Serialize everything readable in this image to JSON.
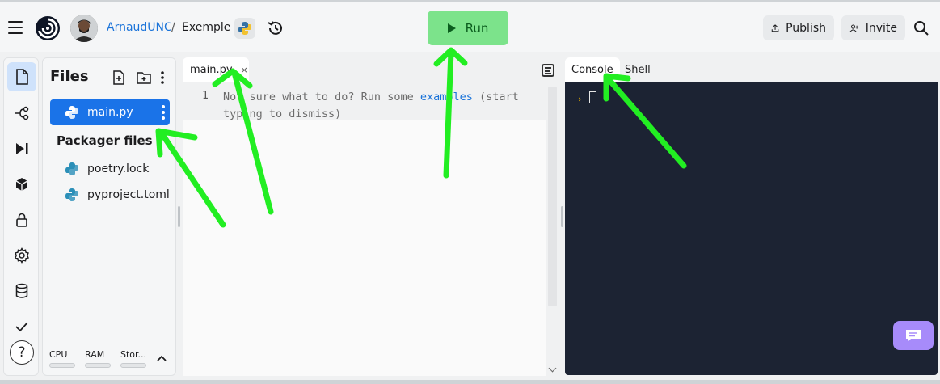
{
  "header": {
    "username": "ArnaudUNC",
    "separator": "/",
    "repl_name": "Exemple",
    "run_label": "Run",
    "publish_label": "Publish",
    "invite_label": "Invite"
  },
  "icons": {
    "menu": "hamburger-icon",
    "logo": "replit-logo",
    "language": "python-icon",
    "history": "history-icon",
    "search": "search-icon"
  },
  "sidebar": {
    "items": [
      {
        "name": "files",
        "icon": "file-icon",
        "active": true
      },
      {
        "name": "git",
        "icon": "git-icon"
      },
      {
        "name": "debugger",
        "icon": "step-forward-icon"
      },
      {
        "name": "packages",
        "icon": "cube-icon"
      },
      {
        "name": "secrets",
        "icon": "lock-icon"
      },
      {
        "name": "settings",
        "icon": "gear-icon"
      },
      {
        "name": "database",
        "icon": "database-icon"
      },
      {
        "name": "unit-tests",
        "icon": "check-icon"
      }
    ],
    "help_label": "?"
  },
  "files": {
    "title": "Files",
    "items": [
      {
        "label": "main.py",
        "selected": true
      }
    ],
    "packager_heading": "Packager files",
    "packager_items": [
      {
        "label": "poetry.lock"
      },
      {
        "label": "pyproject.toml"
      }
    ],
    "resources": [
      {
        "label": "CPU"
      },
      {
        "label": "RAM"
      },
      {
        "label": "Stor..."
      }
    ]
  },
  "editor": {
    "tab_label": "main.py",
    "tab_close": "×",
    "line_number": "1",
    "hint_before": "Not sure what to do? Run some ",
    "hint_link": "examples",
    "hint_after": " (start typing to dismiss)"
  },
  "console": {
    "tabs": [
      {
        "label": "Console",
        "active": true
      },
      {
        "label": "Shell",
        "active": false
      }
    ],
    "prompt": "›"
  },
  "colors": {
    "run_button": "#7ce38b",
    "selected_file": "#1a73e8",
    "console_bg": "#1c2333",
    "annotation_arrow": "#22ee22",
    "chat_button": "#a78bfa"
  }
}
